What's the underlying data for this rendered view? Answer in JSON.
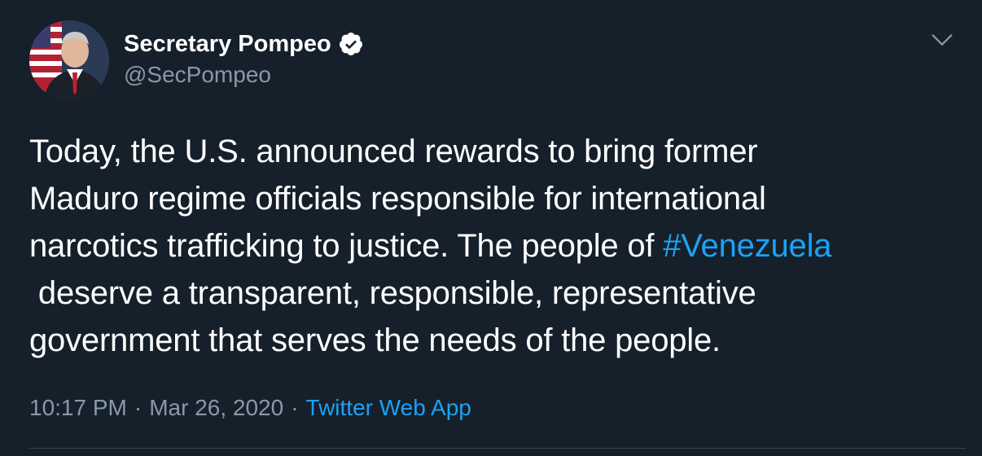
{
  "author": {
    "display_name": "Secretary Pompeo",
    "handle": "@SecPompeo",
    "verified": true,
    "avatar_icon": "profile-photo-icon",
    "verified_icon": "verified-badge-icon"
  },
  "menu": {
    "icon": "chevron-down-icon"
  },
  "tweet": {
    "lines": [
      "Today, the U.S. announced rewards to bring former",
      "Maduro regime officials responsible for international",
      "narcotics trafficking to justice. The people of "
    ],
    "hashtag": "#Venezuela",
    "lines_after": [
      " deserve a transparent, responsible, representative",
      "government that serves the needs of the people."
    ]
  },
  "meta": {
    "time": "10:17 PM",
    "separator": "·",
    "date": "Mar 26, 2020",
    "source": "Twitter Web App"
  },
  "colors": {
    "background": "#15202b",
    "text": "#ffffff",
    "secondary_text": "#8899a6",
    "accent": "#1da1f2",
    "divider": "#38444d"
  }
}
